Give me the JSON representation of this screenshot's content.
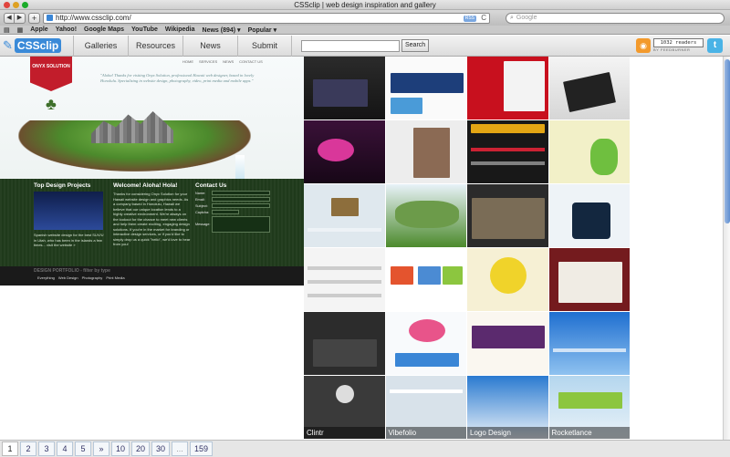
{
  "window": {
    "title": "CSSclip | web design inspiration and gallery"
  },
  "toolbar": {
    "back": "◀",
    "forward": "▶",
    "add": "+",
    "url": "http://www.cssclip.com/",
    "rss": "RSS",
    "reload": "C",
    "search_placeholder": "Google"
  },
  "bookmarks": [
    "Apple",
    "Yahoo!",
    "Google Maps",
    "YouTube",
    "Wikipedia",
    "News (894) ▾",
    "Popular ▾"
  ],
  "site": {
    "logo": "CSSclip",
    "nav": [
      "Galleries",
      "Resources",
      "News",
      "Submit"
    ],
    "search_button": "Search",
    "feed_count": "1032 readers",
    "feed_by": "BY FEEDBURNER",
    "rss_icon": "rss-icon",
    "twitter_icon": "t"
  },
  "featured": {
    "ribbon": "ONYX SOLUTION",
    "nav": [
      "HOME",
      "SERVICES",
      "NEWS",
      "CONTACT US"
    ],
    "quote": "\"Aloha! Thanks for visiting Onyx Solution, professional Hawaii web designer, based in lovely Honolulu. Specializing in website design, photography, video, print media and mobile apps.\"",
    "col1_title": "Top Design Projects",
    "col1_text": "Spanish website design for the best SUV/U in Utah, who has been in the islands a few times... visit the website »",
    "col2_title": "Welcome!  Aloha!  Hola!",
    "col2_text": "Thanks for considering Onyx Solution for your Hawaii website design and graphics needs. As a company based in Honolulu, Hawaii we believe that our unique location lends to a highly creative environment. We're always on the lookout for the chance to meet new clients and help them create exciting, engaging design solutions. If you're in the market for branding or interactive design services, or if you'd like to simply drop us a quick \"hello\", we'd love to hear from you!",
    "col3_title": "Contact Us",
    "fields": [
      "Name:",
      "Email:",
      "Subject:",
      "Captcha:",
      "Message:"
    ],
    "foot_title": "DESIGN PORTFOLIO - filter by type",
    "tags": [
      "Everything",
      "Web Design",
      "Photography",
      "Print Media"
    ]
  },
  "gallery": {
    "labels": [
      "Clintr",
      "Vibefolio",
      "Logo Design",
      "Rocketlance"
    ]
  },
  "pager": [
    "1",
    "2",
    "3",
    "4",
    "5",
    "»",
    "10",
    "20",
    "30",
    "...",
    "159"
  ]
}
